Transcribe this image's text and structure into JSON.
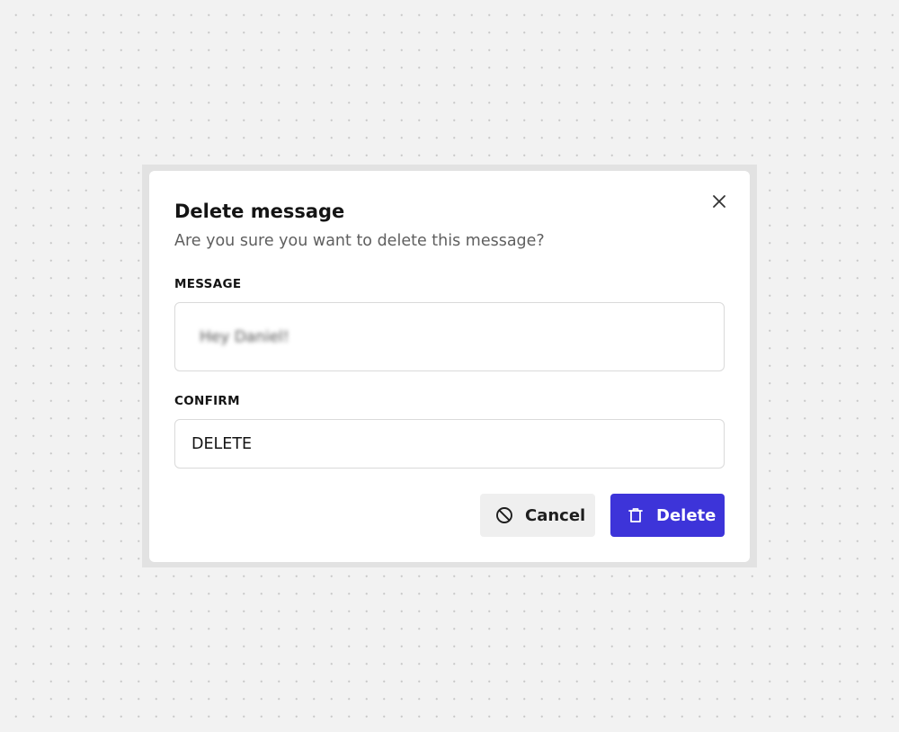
{
  "dialog": {
    "title": "Delete message",
    "subtitle": "Are you sure you want to delete this message?",
    "close_icon": "close-icon"
  },
  "message_field": {
    "label": "MESSAGE",
    "value": "Hey Daniel!",
    "blurred": true
  },
  "confirm_field": {
    "label": "CONFIRM",
    "value": "DELETE"
  },
  "actions": {
    "cancel": {
      "label": "Cancel",
      "icon": "ban-icon"
    },
    "delete": {
      "label": "Delete",
      "icon": "trash-icon"
    }
  },
  "colors": {
    "primary": "#3d34d9",
    "secondary_button_bg": "#efefef",
    "text": "#141414",
    "muted_text": "#5f5f5f",
    "border": "#dadada",
    "page_bg": "#f2f2f2"
  }
}
